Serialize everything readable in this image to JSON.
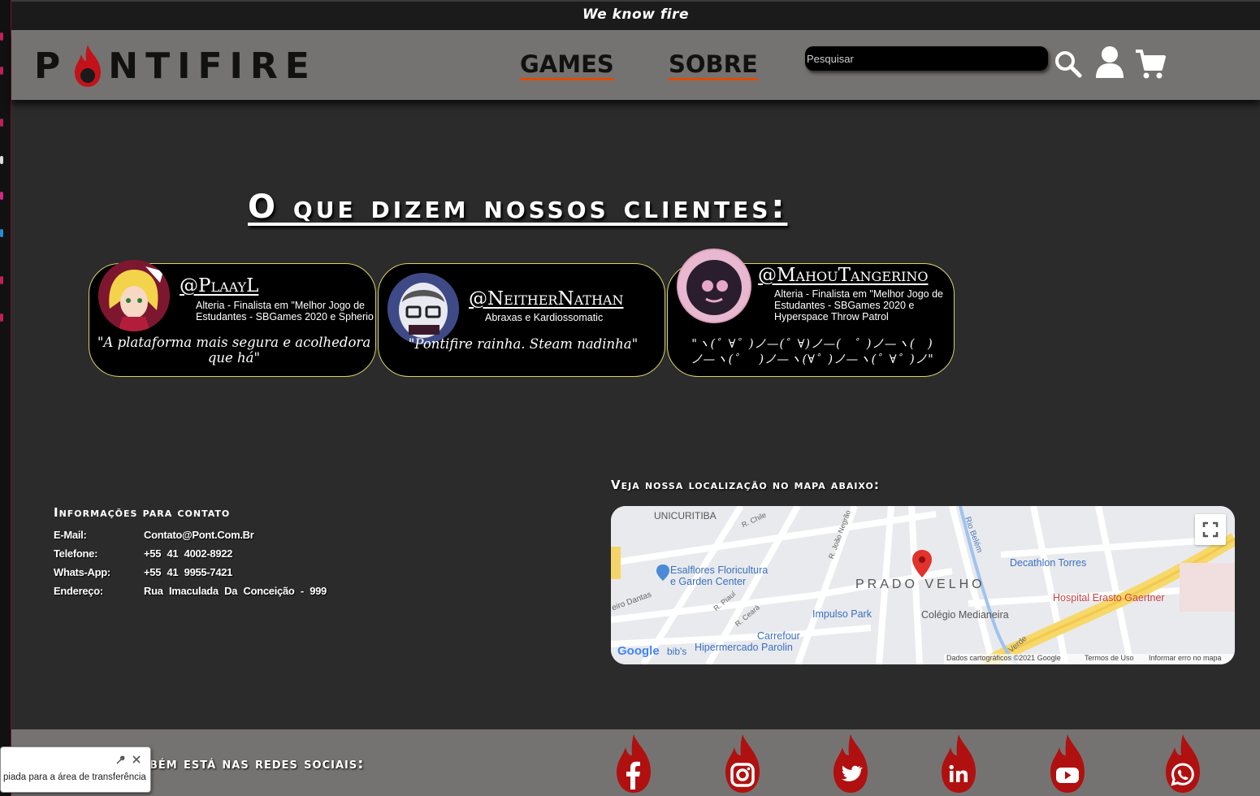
{
  "topbar": {
    "tagline": "We know fire"
  },
  "header": {
    "logo_text_left": "P",
    "logo_text_right": "NTIFIRE",
    "nav": [
      {
        "label": "GAMES"
      },
      {
        "label": "SOBRE"
      }
    ],
    "search_placeholder": "Pesquisar"
  },
  "testimonials": {
    "title": "O que dizem nossos clientes:",
    "cards": [
      {
        "handle": "@PlaayL",
        "role": "Alteria - Finalista em \"Melhor Jogo de Estudantes - SBGames 2020 e Spherio",
        "quote": "\"A plataforma mais segura e acolhedora que há\""
      },
      {
        "handle": "@NeitherNathan",
        "role": "Abraxas e Kardiossomatic",
        "quote": "\"Pontifire rainha. Steam nadinha\""
      },
      {
        "handle": "@MahouTangerino",
        "role": "Alteria - Finalista em \"Melhor Jogo de Estudantes - SBGames 2020 e Hyperspace Throw Patrol",
        "quote": "\"ヽ(゜∀゜)ノ—(゜∀)ノ—(　゜)ノ—ヽ(　)ノ—ヽ(゜　)ノ—ヽ(∀゜)ノ—ヽ(゜∀゜)ノ\""
      }
    ]
  },
  "contact": {
    "title": "Informações para contato",
    "rows": [
      {
        "label": "E-Mail:",
        "value": "Contato@Pont.Com.Br"
      },
      {
        "label": "Telefone:",
        "value": "+55 41 4002-8922"
      },
      {
        "label": "Whats-App:",
        "value": "+55 41 9955-7421"
      },
      {
        "label": "Endereço:",
        "value": "Rua Imaculada Da Conceição - 999"
      }
    ]
  },
  "map": {
    "title": "Veja nossa localização no mapa abaixo:",
    "labels": {
      "unicuritiba": "UNICURITIBA",
      "r_chile": "R. Chile",
      "esalflores": "Esalflores Floricultura",
      "esalflores2": "e Garden Center",
      "prado_velho": "PRADO VELHO",
      "decathlon": "Decathlon Torres",
      "hospital": "Hospital Erasto Gaertner",
      "impulso": "Impulso Park",
      "colegio": "Colégio Medianeira",
      "carrefour": "Carrefour",
      "hipermercado": "Hipermercado Parolin",
      "rio_belem": "Rio Belém",
      "joao_negrao": "R. João Negrão",
      "r_piaui": "R. Piauí",
      "r_ceara": "R. Ceará",
      "dantas": "eiro Dantas",
      "bibs": "bib's",
      "verde": "Verde",
      "google": "Google",
      "credits": "Dados cartográficos ©2021 Google",
      "terms": "Termos de Uso",
      "report": "Informar erro no mapa"
    }
  },
  "footer": {
    "social_title": "bém está nas redes sociais:",
    "social": [
      "facebook",
      "instagram",
      "twitter",
      "linkedin",
      "youtube",
      "whatsapp"
    ]
  },
  "toast": {
    "text": "piada para a área de transferência"
  },
  "colors": {
    "accent": "#e24a00",
    "flame": "#b01010",
    "header": "#757371",
    "bg": "#2b2b2b"
  }
}
